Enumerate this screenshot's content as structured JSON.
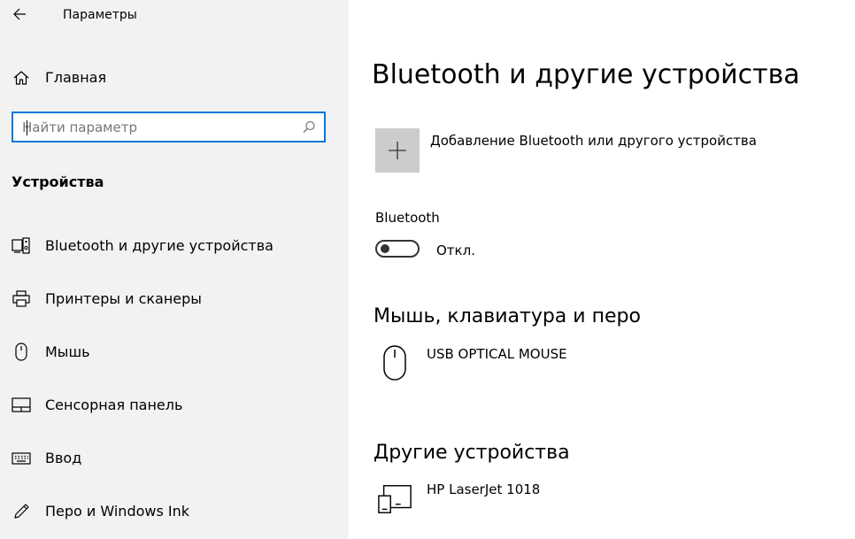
{
  "window": {
    "title": "Параметры"
  },
  "sidebar": {
    "home_label": "Главная",
    "search": {
      "placeholder": "Найти параметр",
      "value": ""
    },
    "section_title": "Устройства",
    "items": [
      {
        "label": "Bluetooth и другие устройства",
        "icon": "bluetooth-devices-icon"
      },
      {
        "label": "Принтеры и сканеры",
        "icon": "printer-icon"
      },
      {
        "label": "Мышь",
        "icon": "mouse-icon"
      },
      {
        "label": "Сенсорная панель",
        "icon": "touchpad-icon"
      },
      {
        "label": "Ввод",
        "icon": "keyboard-icon"
      },
      {
        "label": "Перо и Windows Ink",
        "icon": "pen-icon"
      }
    ]
  },
  "main": {
    "title": "Bluetooth и другие устройства",
    "add_device_label": "Добавление Bluetooth или другого устройства",
    "bluetooth": {
      "label": "Bluetooth",
      "state_label": "Откл.",
      "on": false
    },
    "mouse_section": {
      "title": "Мышь, клавиатура и перо",
      "devices": [
        {
          "name": "USB OPTICAL MOUSE",
          "icon": "mouse-icon"
        }
      ]
    },
    "other_section": {
      "title": "Другие устройства",
      "devices": [
        {
          "name": "HP LaserJet 1018",
          "icon": "device-icon"
        }
      ]
    }
  },
  "colors": {
    "sidebar_bg": "#f2f2f2",
    "accent": "#0078d7",
    "add_button_bg": "#cccccc"
  }
}
